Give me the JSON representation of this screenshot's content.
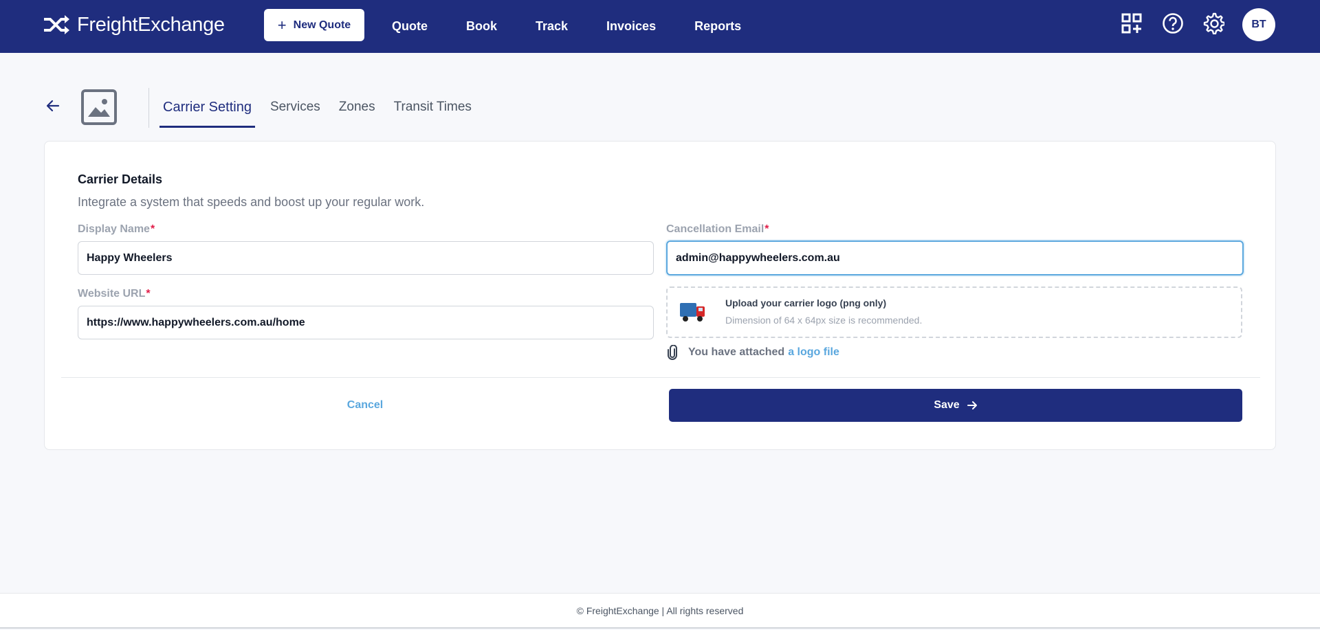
{
  "brand": {
    "name": "FreightExchange",
    "icon": "shuffle-arrows-icon"
  },
  "topnav": {
    "new_quote_label": "New Quote",
    "links": [
      "Quote",
      "Book",
      "Track",
      "Invoices",
      "Reports"
    ],
    "icons": [
      "apps-add-icon",
      "help-circle-icon",
      "gear-icon"
    ],
    "avatar_initials": "BT"
  },
  "header": {
    "tabs": [
      "Carrier Setting",
      "Services",
      "Zones",
      "Transit Times"
    ],
    "active_tab": "Carrier Setting"
  },
  "card": {
    "title": "Carrier Details",
    "subtitle": "Integrate a system that speeds and boost up your regular work.",
    "display_name": {
      "label": "Display Name",
      "value": "Happy Wheelers"
    },
    "cancellation_email": {
      "label": "Cancellation Email",
      "value": "admin@happywheelers.com.au"
    },
    "website_url": {
      "label": "Website URL",
      "value": "https://www.happywheelers.com.au/home"
    },
    "upload": {
      "title": "Upload your carrier logo (png only)",
      "hint": "Dimension of 64 x 64px size is recommended."
    },
    "attached_text": "You have attached",
    "attached_link": "a logo file",
    "cancel_label": "Cancel",
    "save_label": "Save"
  },
  "footer": {
    "text": "© FreightExchange | All rights reserved"
  },
  "colors": {
    "brand_navy": "#1f2d7e",
    "accent_blue": "#5aa7de",
    "required_red": "#e11d48"
  }
}
